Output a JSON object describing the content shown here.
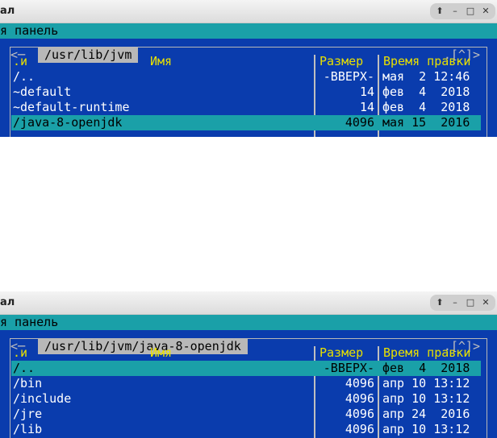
{
  "windows": [
    {
      "title": "ал",
      "menu_text": "я панель",
      "frame_left": "<─",
      "path": "/usr/lib/jvm",
      "frame_right": ".[^]>",
      "header": {
        "col1": ".и",
        "col2": "Имя",
        "size": "Размер",
        "date": "Время правки"
      },
      "rows": [
        {
          "name": "/..",
          "size": "-ВВЕРХ-",
          "date": "мая  2 12:46",
          "selected": false
        },
        {
          "name": "~default",
          "size": "14",
          "date": "фев  4  2018",
          "selected": false
        },
        {
          "name": "~default-runtime",
          "size": "14",
          "date": "фев  4  2018",
          "selected": false
        },
        {
          "name": "/java-8-openjdk",
          "size": "4096",
          "date": "мая 15  2016",
          "selected": true
        }
      ]
    },
    {
      "title": "ал",
      "menu_text": "я панель",
      "frame_left": "<─",
      "path": "/usr/lib/jvm/java-8-openjdk",
      "frame_right": ".[^]>",
      "header": {
        "col1": ".и",
        "col2": "Имя",
        "size": "Размер",
        "date": "Время правки"
      },
      "rows": [
        {
          "name": "/..",
          "size": "-ВВЕРХ-",
          "date": "фев  4  2018",
          "selected": true
        },
        {
          "name": "/bin",
          "size": "4096",
          "date": "апр 10 13:12",
          "selected": false
        },
        {
          "name": "/include",
          "size": "4096",
          "date": "апр 10 13:12",
          "selected": false
        },
        {
          "name": "/jre",
          "size": "4096",
          "date": "апр 24  2016",
          "selected": false
        },
        {
          "name": "/lib",
          "size": "4096",
          "date": "апр 10 13:12",
          "selected": false
        }
      ]
    }
  ],
  "window_buttons": {
    "up": "⬆",
    "minimize": "–",
    "maximize": "□",
    "close": "✕"
  },
  "colors": {
    "panel_bg": "#0a3cad",
    "menubar_bg": "#1aa0a8",
    "header_fg": "#e8e000",
    "cursor_bg": "#1aa0a8"
  }
}
